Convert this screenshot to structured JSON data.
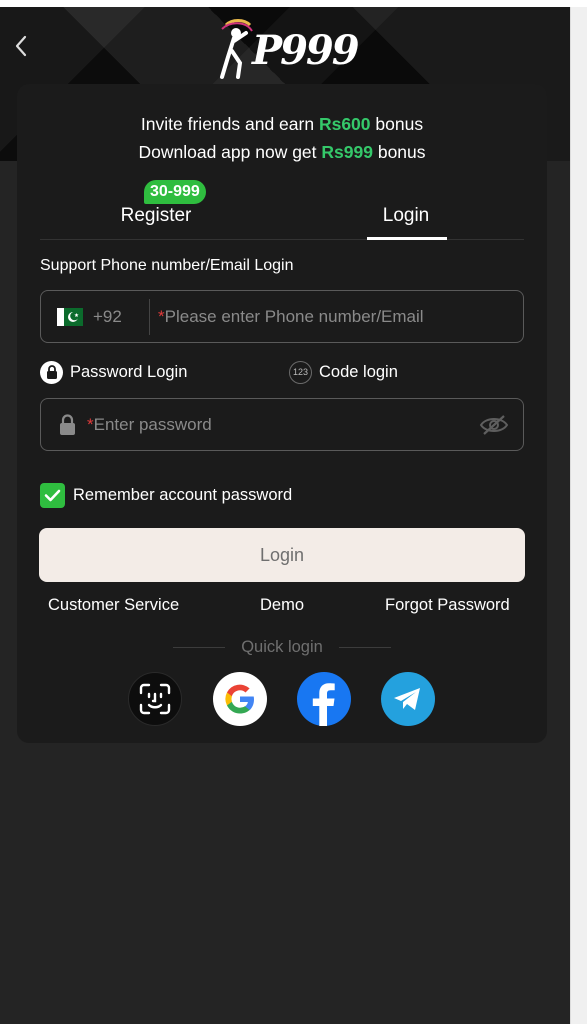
{
  "header": {
    "back_icon": "chevron-left-icon",
    "logo_text": "P999"
  },
  "promo": {
    "line1_prefix": "Invite friends and earn ",
    "line1_amount": "Rs600",
    "line1_suffix": " bonus",
    "line2_prefix": "Download app now get ",
    "line2_amount": "Rs999",
    "line2_suffix": " bonus",
    "amount_color": "#35c86a"
  },
  "tabs": {
    "register_label": "Register",
    "login_label": "Login",
    "active": "Login",
    "badge": "30-999"
  },
  "form": {
    "support_label": "Support Phone number/Email Login",
    "country_code": "+92",
    "phone_placeholder": "Please enter Phone number/Email",
    "required_mark": "*",
    "methods": {
      "password_label": "Password Login",
      "code_label": "Code login",
      "code_icon_text": "123"
    },
    "password_placeholder": "Enter password",
    "remember_label": "Remember account password",
    "remember_checked": true,
    "login_button": "Login"
  },
  "links": {
    "customer_service": "Customer Service",
    "demo": "Demo",
    "forgot_password": "Forgot Password"
  },
  "quick_login": {
    "label": "Quick login",
    "providers": [
      "face-id-icon",
      "google-icon",
      "facebook-icon",
      "telegram-icon"
    ]
  },
  "colors": {
    "background": "#242424",
    "card": "#1b1b1b",
    "accent_green": "#2fbd3f"
  }
}
